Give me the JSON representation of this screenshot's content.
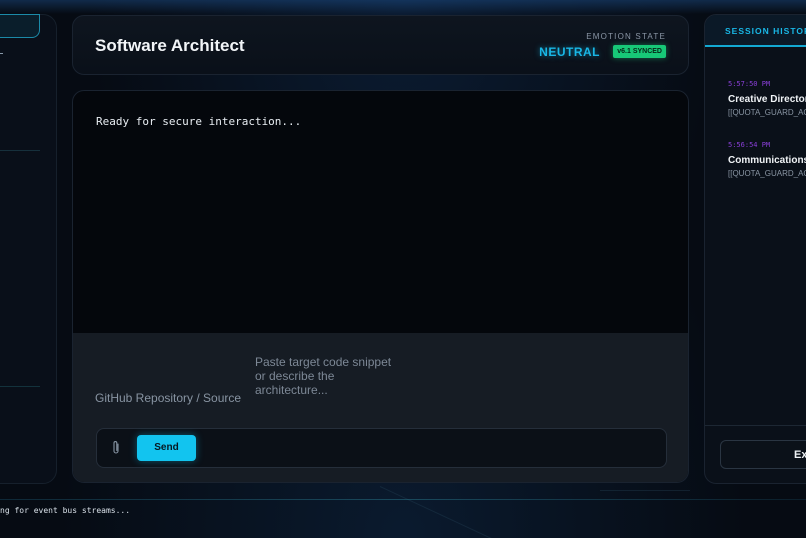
{
  "header": {
    "agent_title": "Software Architect",
    "emotion_label": "EMOTION STATE",
    "emotion_value": "NEUTRAL",
    "sync_badge": "v6.1 SYNCED"
  },
  "chat": {
    "output_text": "Ready for secure interaction...",
    "repo_placeholder": "GitHub Repository / Source",
    "code_placeholder": "Paste target code snippet or describe the architecture...",
    "attach_icon": "paperclip-icon",
    "send_label": "Send"
  },
  "history": {
    "tab_label": "SESSION HISTORY",
    "sessions": [
      {
        "time": "5:57:50 PM",
        "name": "Creative Director",
        "summary": "[[QUOTA_GUARD_AC"
      },
      {
        "time": "5:56:54 PM",
        "name": "Communications",
        "summary": "[[QUOTA_GUARD_AC"
      }
    ],
    "export_label": "Ex"
  },
  "status": {
    "text": "ng for event bus streams..."
  },
  "colors": {
    "accent": "#12c4ef",
    "success": "#17c877",
    "timestamp": "#8a3fd8",
    "background": "#060b13"
  }
}
